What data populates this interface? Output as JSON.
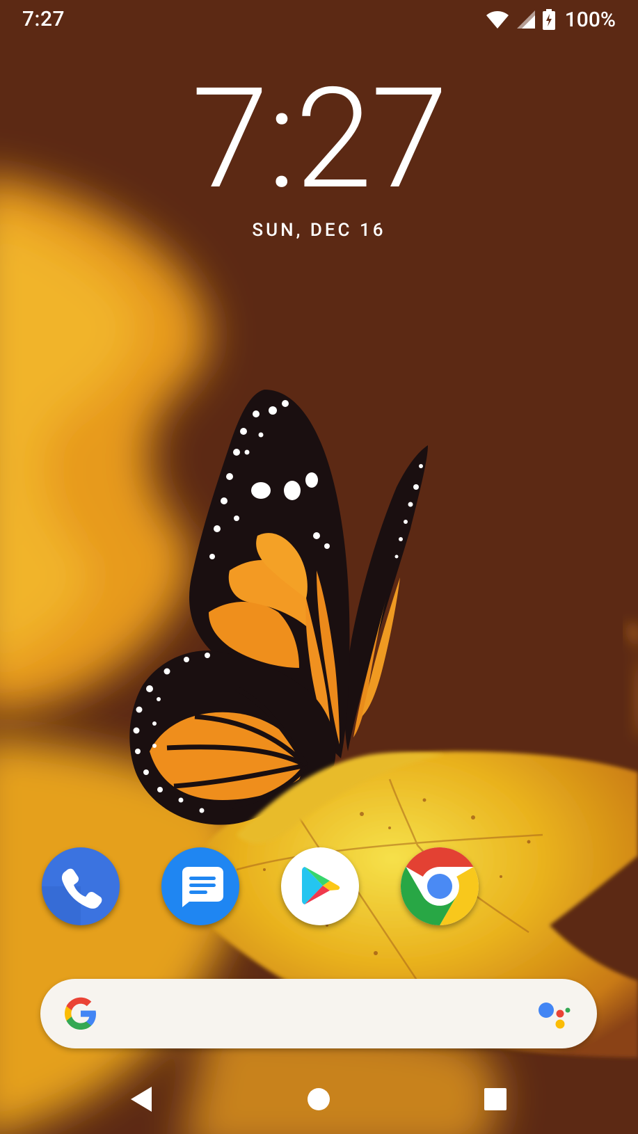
{
  "status_bar": {
    "time": "7:27",
    "battery_percent": "100%",
    "icons": [
      "wifi-icon",
      "cell-signal-icon",
      "battery-charging-icon"
    ]
  },
  "lock_clock": {
    "time": "7:27",
    "date": "SUN, DEC 16"
  },
  "wallpaper": {
    "subject": "monarch-butterfly-on-yellow-leaf",
    "background_color": "#5e2a14"
  },
  "dock": {
    "apps": [
      {
        "name": "Phone",
        "icon": "phone-icon",
        "color": "#3b73e0"
      },
      {
        "name": "Messages",
        "icon": "messages-icon",
        "color": "#1f86f2"
      },
      {
        "name": "Play Store",
        "icon": "play-store-icon",
        "color": "#ffffff"
      },
      {
        "name": "Chrome",
        "icon": "chrome-icon",
        "color": "#ffffff"
      }
    ]
  },
  "search_bar": {
    "icons": [
      "google-g-icon",
      "google-assistant-icon"
    ],
    "background": "#f7f4ef"
  },
  "nav_bar": {
    "buttons": [
      "back-icon",
      "home-icon",
      "recents-icon"
    ]
  }
}
